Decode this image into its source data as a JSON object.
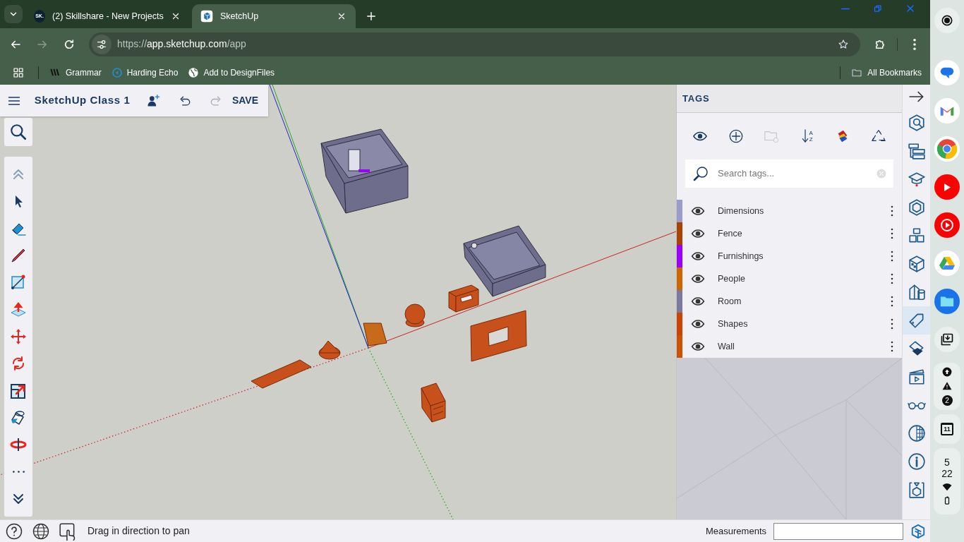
{
  "browser": {
    "tabs": [
      {
        "title": "(2) Skillshare - New Projects",
        "favicon_text": "SK.",
        "selected": false
      },
      {
        "title": "SketchUp",
        "selected": true
      }
    ],
    "forward_disabled": true,
    "url": {
      "scheme": "https://",
      "host": "app.sketchup.com",
      "path": "/app"
    },
    "bookmarks": [
      {
        "label": "Grammar",
        "kind": "grammar"
      },
      {
        "label": "Harding Echo",
        "kind": "echo"
      },
      {
        "label": "Add to DesignFiles",
        "kind": "globe"
      }
    ],
    "all_bookmarks": "All Bookmarks"
  },
  "app": {
    "title": "SketchUp Class 1",
    "save": "SAVE",
    "redo_disabled": true,
    "tags_panel": {
      "title": "TAGS",
      "toolbar": [
        {
          "kind": "eye",
          "disabled": false
        },
        {
          "kind": "add",
          "disabled": false
        },
        {
          "kind": "folder",
          "disabled": true
        },
        {
          "kind": "sort",
          "disabled": false,
          "letters": [
            "A",
            "Z"
          ]
        },
        {
          "kind": "colorize",
          "disabled": false
        },
        {
          "kind": "purge",
          "disabled": false
        }
      ],
      "search": {
        "placeholder": "Search tags..."
      },
      "tags": [
        {
          "name": "Dimensions",
          "color": "#9c9ccc",
          "visible": true
        },
        {
          "name": "Fence",
          "color": "#a84300",
          "visible": true
        },
        {
          "name": "Furnishings",
          "color": "#9900ff",
          "visible": true
        },
        {
          "name": "People",
          "color": "#cc6600",
          "visible": true
        },
        {
          "name": "Room",
          "color": "#7a7a9c",
          "visible": true
        },
        {
          "name": "Shapes",
          "color": "#cc4400",
          "visible": true
        },
        {
          "name": "Wall",
          "color": "#cc5200",
          "visible": true
        }
      ]
    },
    "side_icons": [
      {
        "kind": "collapse",
        "selected": false
      },
      {
        "kind": "entity",
        "selected": false
      },
      {
        "kind": "outliner",
        "selected": false
      },
      {
        "kind": "instructor",
        "selected": false
      },
      {
        "kind": "components",
        "selected": false
      },
      {
        "kind": "cubes",
        "selected": false
      },
      {
        "kind": "materials",
        "selected": false
      },
      {
        "kind": "solids",
        "selected": false
      },
      {
        "kind": "tags",
        "selected": true
      },
      {
        "kind": "styles",
        "selected": false
      },
      {
        "kind": "scenes",
        "selected": false
      },
      {
        "kind": "display",
        "selected": false
      },
      {
        "kind": "shadows",
        "selected": false
      },
      {
        "kind": "info",
        "selected": false
      },
      {
        "kind": "warehouse",
        "selected": false
      }
    ]
  },
  "status_bar": {
    "hint": "Drag in direction to pan",
    "measurements_label": "Measurements"
  },
  "shelf": {
    "notification_count": "2",
    "calendar_day": "11",
    "time_hour": "5",
    "time_minute": "22"
  }
}
